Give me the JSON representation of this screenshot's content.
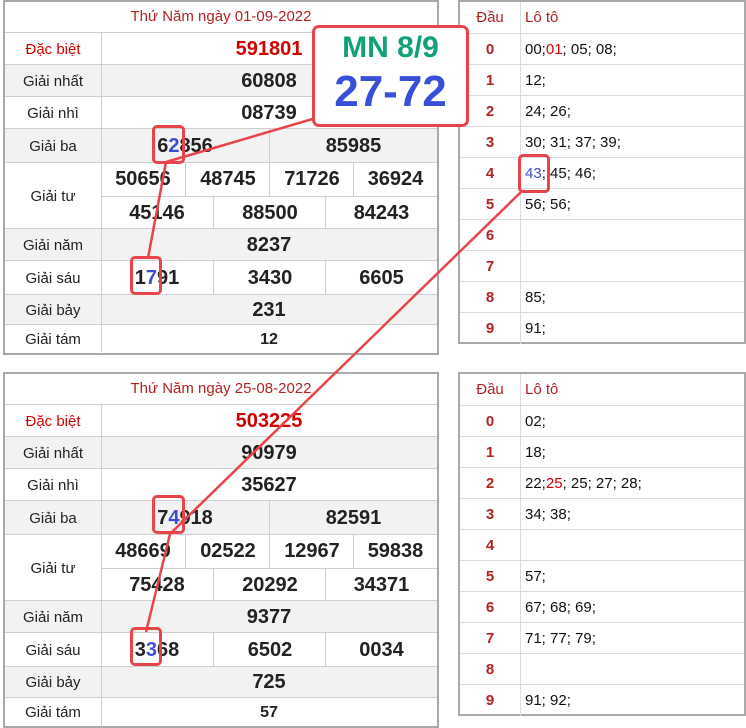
{
  "top": {
    "title": "Thứ Năm ngày 01-09-2022",
    "prizes": {
      "db_label": "Đặc biệt",
      "db": "591801",
      "g1_label": "Giải nhất",
      "g1": "60808",
      "g2_label": "Giải nhì",
      "g2": "08739",
      "g3_label": "Giải ba",
      "g3a_pre": "6",
      "g3a_hl": "2",
      "g3a_post": "856",
      "g3b": "85985",
      "g4_label": "Giải tư",
      "g4": [
        "50656",
        "48745",
        "71726",
        "36924",
        "45146",
        "88500",
        "84243"
      ],
      "g5_label": "Giải năm",
      "g5": "8237",
      "g6_label": "Giải sáu",
      "g6a_pre": "1",
      "g6a_hl": "7",
      "g6a_post": "91",
      "g6b": "3430",
      "g6c": "6605",
      "g7_label": "Giải bảy",
      "g7": "231",
      "g8_label": "Giải tám",
      "g8": "12"
    },
    "loto_head": {
      "dau": "Đầu",
      "loto": "Lô tô"
    },
    "loto": [
      {
        "dau": "0",
        "parts": [
          {
            "t": "00; "
          },
          {
            "t": "01",
            "c": "red"
          },
          {
            "t": "; 05; 08;"
          }
        ]
      },
      {
        "dau": "1",
        "parts": [
          {
            "t": "12;"
          }
        ]
      },
      {
        "dau": "2",
        "parts": [
          {
            "t": "24; 26;"
          }
        ]
      },
      {
        "dau": "3",
        "parts": [
          {
            "t": "30; 31; 37; 39;"
          }
        ]
      },
      {
        "dau": "4",
        "parts": [
          {
            "t": "43",
            "c": "hl"
          },
          {
            "t": "; 45; 46;"
          }
        ]
      },
      {
        "dau": "5",
        "parts": [
          {
            "t": "56; 56;"
          }
        ]
      },
      {
        "dau": "6",
        "parts": []
      },
      {
        "dau": "7",
        "parts": []
      },
      {
        "dau": "8",
        "parts": [
          {
            "t": "85;"
          }
        ]
      },
      {
        "dau": "9",
        "parts": [
          {
            "t": "91;"
          }
        ]
      }
    ]
  },
  "bottom": {
    "title": "Thứ Năm ngày 25-08-2022",
    "prizes": {
      "db_label": "Đặc biệt",
      "db": "503225",
      "g1_label": "Giải nhất",
      "g1": "90979",
      "g2_label": "Giải nhì",
      "g2": "35627",
      "g3_label": "Giải ba",
      "g3a_pre": "7",
      "g3a_hl": "4",
      "g3a_post": "918",
      "g3b": "82591",
      "g4_label": "Giải tư",
      "g4": [
        "48669",
        "02522",
        "12967",
        "59838",
        "75428",
        "20292",
        "34371"
      ],
      "g5_label": "Giải năm",
      "g5": "9377",
      "g6_label": "Giải sáu",
      "g6a_pre": "3",
      "g6a_hl": "3",
      "g6a_post": "68",
      "g6b": "6502",
      "g6c": "0034",
      "g7_label": "Giải bảy",
      "g7": "725",
      "g8_label": "Giải tám",
      "g8": "57"
    },
    "loto_head": {
      "dau": "Đầu",
      "loto": "Lô tô"
    },
    "loto": [
      {
        "dau": "0",
        "parts": [
          {
            "t": "02;"
          }
        ]
      },
      {
        "dau": "1",
        "parts": [
          {
            "t": "18;"
          }
        ]
      },
      {
        "dau": "2",
        "parts": [
          {
            "t": "22; "
          },
          {
            "t": "25",
            "c": "red"
          },
          {
            "t": "; 25; 27; 28;"
          }
        ]
      },
      {
        "dau": "3",
        "parts": [
          {
            "t": "34; 38;"
          }
        ]
      },
      {
        "dau": "4",
        "parts": []
      },
      {
        "dau": "5",
        "parts": [
          {
            "t": "57;"
          }
        ]
      },
      {
        "dau": "6",
        "parts": [
          {
            "t": "67; 68; 69;"
          }
        ]
      },
      {
        "dau": "7",
        "parts": [
          {
            "t": "71; 77; 79;"
          }
        ]
      },
      {
        "dau": "8",
        "parts": []
      },
      {
        "dau": "9",
        "parts": [
          {
            "t": "91; 92;"
          }
        ]
      }
    ]
  },
  "callout": {
    "region": "MN 8/9",
    "numbers": "27-72"
  },
  "colors": {
    "highlight": "#3a4fd8",
    "accent_red": "#e8454a",
    "callout_green": "#12a07a",
    "title_red": "#b22222"
  }
}
